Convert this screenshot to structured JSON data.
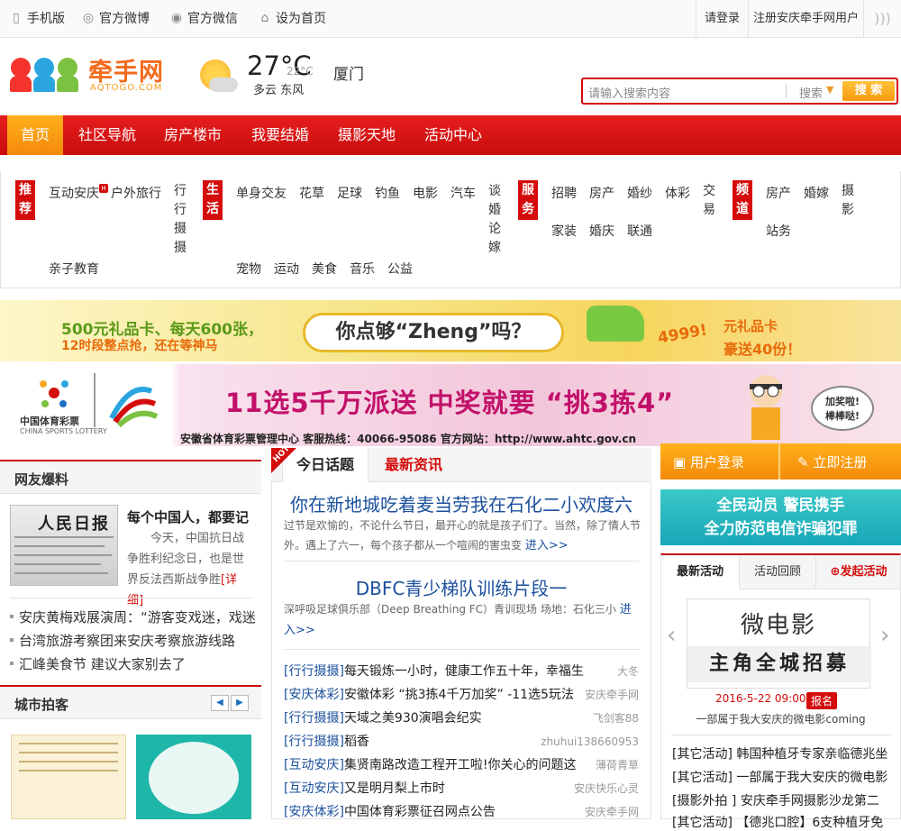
{
  "topbar": {
    "links": [
      "手机版",
      "官方微博",
      "官方微信",
      "设为首页"
    ],
    "login": "请登录",
    "register": "注册安庆牵手网用户"
  },
  "logo": {
    "main": "牵手网",
    "sub": "AQTOGO.COM"
  },
  "weather": {
    "temp": "27",
    "unit": "°C",
    "low": "22°C",
    "desc": "多云  东风",
    "city": "厦门"
  },
  "search": {
    "placeholder": "请输入搜索内容",
    "type": "搜索",
    "button": "搜 索"
  },
  "nav": [
    "首页",
    "社区导航",
    "房产楼市",
    "我要结婚",
    "摄影天地",
    "活动中心"
  ],
  "categories": {
    "rec": {
      "tag": "推荐",
      "items": [
        "互动安庆",
        "户外旅行",
        "行行摄摄",
        "亲子教育"
      ]
    },
    "life": {
      "tag": "生活",
      "items": [
        "单身交友",
        "花草",
        "足球",
        "钓鱼",
        "电影",
        "汽车",
        "谈婚论嫁",
        "宠物",
        "运动",
        "美食",
        "音乐",
        "公益"
      ]
    },
    "service": {
      "tag": "服务",
      "items": [
        "招聘",
        "房产",
        "婚纱",
        "体彩",
        "交易",
        "家装",
        "婚庆",
        "联通"
      ]
    },
    "channel": {
      "tag": "频道",
      "items": [
        "房产",
        "婚嫁",
        "摄影",
        "站务"
      ]
    }
  },
  "banner1": {
    "left1": "500元礼品卡、每天600张，",
    "left2": "12时段整点抢，还在等神马",
    "center": "你点够“Zheng”吗？",
    "price": "4999!",
    "right1": "元礼品卡",
    "right2": "豪送40份！"
  },
  "banner2": {
    "brand": "中国体育彩票",
    "brand_en": "CHINA SPORTS LOTTERY",
    "headline": "11选5千万派送  中奖就要 “挑3拣4”",
    "bubble1": "加奖啦!",
    "bubble2": "棒棒哒!",
    "footer": "安徽省体育彩票管理中心  客服热线：40066-95086  官方网站：http://www.ahtc.gov.cn"
  },
  "left": {
    "section1": "网友爆料",
    "paper": "人民日报",
    "feature_title": "每个中国人，都要记",
    "feature_desc": "今天，中国抗日战争胜利纪念日，也是世界反法西斯战争胜",
    "feature_more": "[详细]",
    "news": [
      "安庆黄梅戏展演周：“游客变戏迷，戏迷",
      "台湾旅游考察团来安庆考察旅游线路",
      "汇峰美食节  建议大家别去了"
    ],
    "section2": "城市拍客"
  },
  "middle": {
    "tab_today": "今日话题",
    "tab_news": "最新资讯",
    "hot": "HOT",
    "headline1": "你在新地城吃着麦当劳我在石化二小欢度六",
    "desc1": "过节是欢愉的，不论什么节日，最开心的就是孩子们了。当然，除了情人节外。遇上了六一，每个孩子都从一个喧闹的害虫变",
    "more": "进入>>",
    "headline2": "DBFC青少梯队训练片段一",
    "desc2": "深呼吸足球俱乐部（Deep Breathing FC）青训现场  场地：石化三小",
    "list": [
      {
        "cat": "[行行摄摄]",
        "title": "每天锻炼一小时，健康工作五十年，幸福生",
        "author": "大冬"
      },
      {
        "cat": "[安庆体彩]",
        "title": "安徽体彩 “挑3拣4千万加奖” -11选5玩法",
        "author": "安庆牵手网"
      },
      {
        "cat": "[行行摄摄]",
        "title": "天域之美930演唱会纪实",
        "author": "飞剑客88"
      },
      {
        "cat": "[行行摄摄]",
        "title": "稻香",
        "author": "zhuhui138660953"
      },
      {
        "cat": "[互动安庆]",
        "title": "集贤南路改造工程开工啦!你关心的问题这",
        "author": "薄荷青草"
      },
      {
        "cat": "[互动安庆]",
        "title": "又是明月梨上市时",
        "author": "安庆快乐心灵"
      },
      {
        "cat": "[安庆体彩]",
        "title": "中国体育彩票征召网点公告",
        "author": "安庆牵手网"
      }
    ]
  },
  "right": {
    "login": "用户登录",
    "register": "立即注册",
    "banner1": "全民动员  警民携手",
    "banner2": "全力防范电信诈骗犯罪",
    "tabs": [
      "最新活动",
      "活动回顾",
      "发起活动"
    ],
    "poster1": "微电影",
    "poster2": "主角全城招募",
    "date": "2016-5-22 09:00",
    "badge": "报名",
    "caption": "一部属于我大安庆的微电影coming",
    "list": [
      "[其它活动] 韩国种植牙专家亲临德兆坐",
      "[其它活动] 一部属于我大安庆的微电影",
      "[摄影外拍 ] 安庆牵手网摄影沙龙第二",
      "[其它活动] 【德兆口腔】6支种植牙免"
    ]
  }
}
